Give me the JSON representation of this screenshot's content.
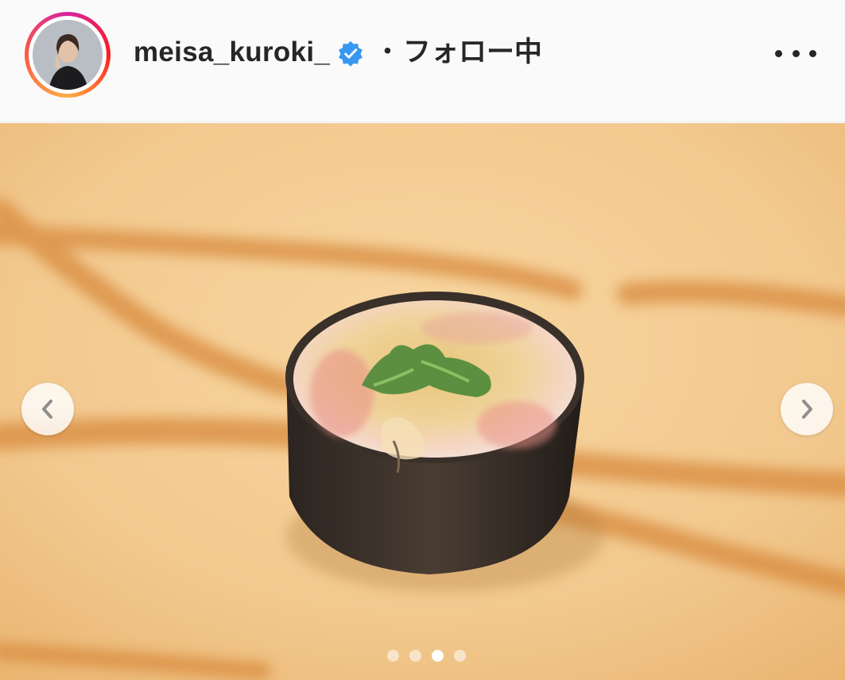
{
  "post_header": {
    "username": "meisa_kuroki_",
    "separator": "・",
    "follow_status": "フォロー中",
    "verified": true,
    "more_icon": "more-options-icon",
    "avatar_ring_colors": [
      "#d6249f",
      "#fd1d1d",
      "#fcaf45"
    ]
  },
  "carousel": {
    "prev_icon": "chevron-left-icon",
    "next_icon": "chevron-right-icon",
    "slide_count": 4,
    "active_index": 2
  },
  "colors": {
    "verified_blue": "#3897f0",
    "text": "#262626"
  }
}
